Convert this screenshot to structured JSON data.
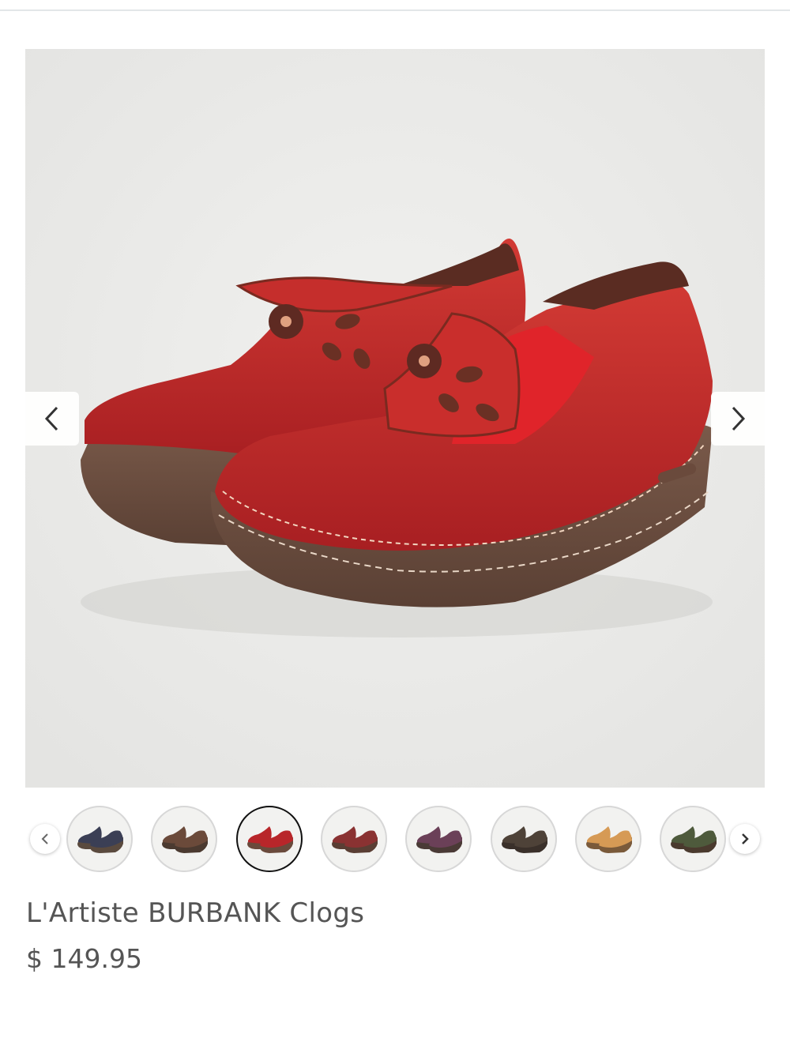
{
  "product": {
    "title": "L'Artiste BURBANK Clogs",
    "price": "$ 149.95",
    "main_image_alt": "Red leather clogs"
  },
  "gallery": {
    "prev_icon": "chevron-left-icon",
    "next_icon": "chevron-right-icon"
  },
  "swatches": [
    {
      "name": "navy",
      "color": "#3b3f55",
      "sole": "#5a4a3e"
    },
    {
      "name": "brown",
      "color": "#6b4a3a",
      "sole": "#4b3a30"
    },
    {
      "name": "red",
      "color": "#b8262a",
      "sole": "#6a4a3c",
      "selected": true
    },
    {
      "name": "bordeaux",
      "color": "#8a3232",
      "sole": "#5a3e34"
    },
    {
      "name": "plum",
      "color": "#6b4058",
      "sole": "#4a3a36"
    },
    {
      "name": "dark-brown",
      "color": "#4e4238",
      "sole": "#3a302a"
    },
    {
      "name": "camel",
      "color": "#d69a55",
      "sole": "#7a5a3a"
    },
    {
      "name": "olive",
      "color": "#4e5a3c",
      "sole": "#4a3a2e"
    }
  ],
  "colors": {
    "text": "#555555",
    "selected_border": "#111111",
    "background": "#ececea"
  }
}
